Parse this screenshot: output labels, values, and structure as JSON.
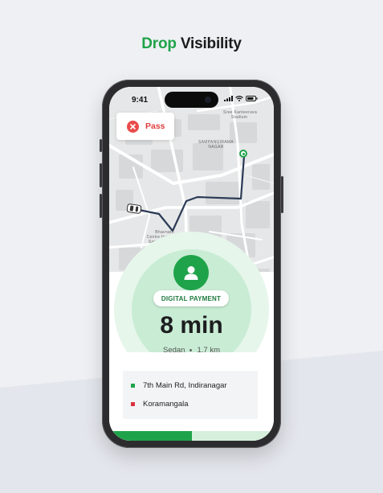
{
  "headline": {
    "accent": "Drop",
    "rest": "Visibility"
  },
  "status_bar": {
    "time": "9:41"
  },
  "pass_button": {
    "label": "Pass"
  },
  "map": {
    "labels": {
      "area": "SAMPANGIRAMA\nNAGAR",
      "stadium": "Sree Kanteerava\nStadium",
      "center": "Bhavnath\nCentre for Art and\nSamad Heritage"
    }
  },
  "trip": {
    "payment_badge": "DIGITAL PAYMENT",
    "eta": "8 min",
    "vehicle": "Sedan",
    "distance": "1.7 km",
    "progress": 0.5
  },
  "route": {
    "pickup": "7th Main Rd, Indiranagar",
    "drop": "Koramangala"
  },
  "colors": {
    "accent": "#1fa34a",
    "danger": "#e94b4b",
    "drop_marker": "#d9333f"
  },
  "icons": [
    "close-icon",
    "user-icon",
    "car-icon",
    "signal-icon",
    "wifi-icon",
    "battery-icon"
  ]
}
